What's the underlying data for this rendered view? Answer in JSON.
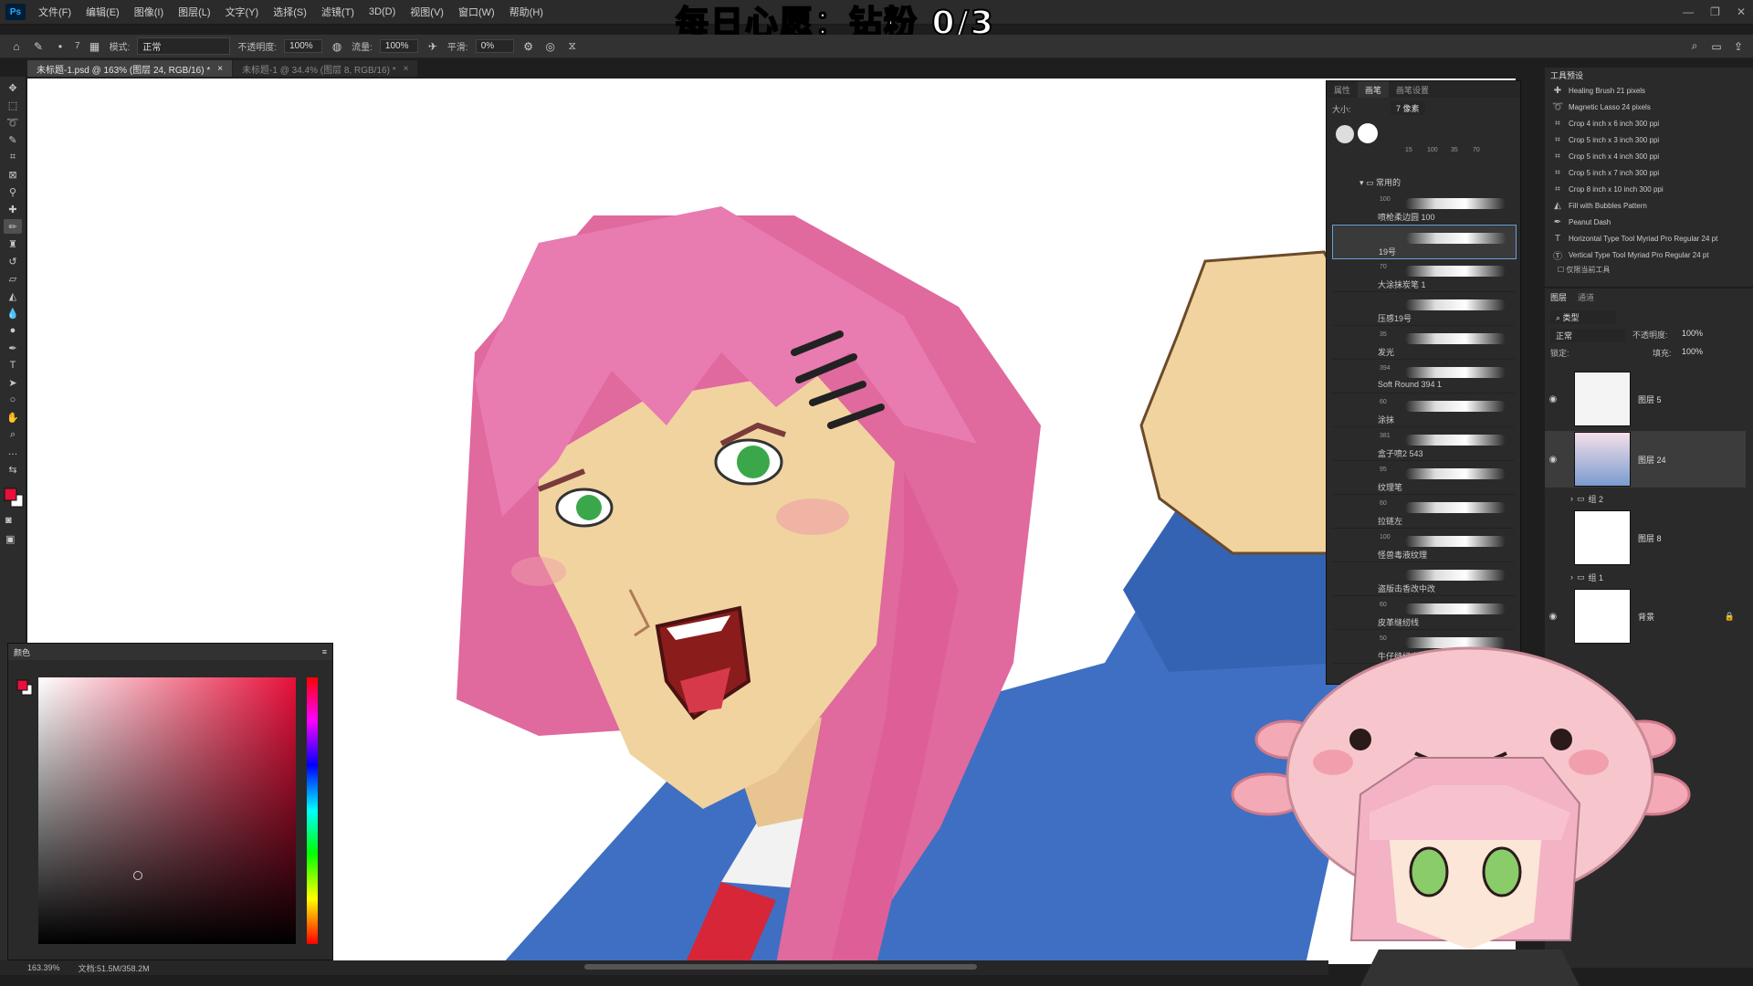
{
  "app": {
    "logo": "Ps"
  },
  "menubar": {
    "items": [
      "文件(F)",
      "编辑(E)",
      "图像(I)",
      "图层(L)",
      "文字(Y)",
      "选择(S)",
      "滤镜(T)",
      "3D(D)",
      "视图(V)",
      "窗口(W)",
      "帮助(H)"
    ]
  },
  "overlay": {
    "title": "每日心愿：钻粉 0/3"
  },
  "options": {
    "brush_size": "7",
    "mode_label": "模式:",
    "mode_value": "正常",
    "opacity_label": "不透明度:",
    "opacity_value": "100%",
    "flow_label": "流量:",
    "flow_value": "100%",
    "smooth_label": "平滑:",
    "smooth_value": "0%"
  },
  "tabs": [
    {
      "label": "未标题-1.psd @ 163% (图层 24, RGB/16) *"
    },
    {
      "label": "未标题-1 @ 34.4% (图层 8, RGB/16) *"
    }
  ],
  "status": {
    "zoom": "163.39%",
    "doc": "文档:51.5M/358.2M"
  },
  "color_panel": {
    "title": "颜色",
    "fg": "#e8103a",
    "bg": "#ffffff"
  },
  "brush_panel": {
    "tabs": [
      "属性",
      "画笔",
      "画笔设置"
    ],
    "size_label": "大小:",
    "size_value": "7 像素",
    "tip_sizes": [
      "15",
      "100",
      "35",
      "70"
    ],
    "folder": "常用的",
    "brushes": [
      {
        "size": "100",
        "name": "喷枪柔边圆 100"
      },
      {
        "size": "",
        "name": "19号"
      },
      {
        "size": "70",
        "name": "大涂抹炭笔 1"
      },
      {
        "size": "",
        "name": "压感19号"
      },
      {
        "size": "35",
        "name": "发光"
      },
      {
        "size": "394",
        "name": "Soft Round 394 1"
      },
      {
        "size": "60",
        "name": "涂抹"
      },
      {
        "size": "381",
        "name": "盒子喷2 543"
      },
      {
        "size": "95",
        "name": "纹理笔"
      },
      {
        "size": "60",
        "name": "拉链左"
      },
      {
        "size": "100",
        "name": "怪兽毒液纹理"
      },
      {
        "size": "",
        "name": "盗版击香改中改"
      },
      {
        "size": "60",
        "name": "皮革缝纫线"
      },
      {
        "size": "50",
        "name": "牛仔缝纫实验"
      }
    ]
  },
  "presets_panel": {
    "title": "工具预设",
    "items": [
      {
        "icon": "healing-brush-icon",
        "name": "Healing Brush 21 pixels"
      },
      {
        "icon": "magnetic-lasso-icon",
        "name": "Magnetic Lasso 24 pixels"
      },
      {
        "icon": "crop-icon",
        "name": "Crop 4 inch x 6 inch 300 ppi"
      },
      {
        "icon": "crop-icon",
        "name": "Crop 5 inch x 3 inch 300 ppi"
      },
      {
        "icon": "crop-icon",
        "name": "Crop 5 inch x 4 inch 300 ppi"
      },
      {
        "icon": "crop-icon",
        "name": "Crop 5 inch x 7 inch 300 ppi"
      },
      {
        "icon": "crop-icon",
        "name": "Crop 8 inch x 10 inch 300 ppi"
      },
      {
        "icon": "paint-bucket-icon",
        "name": "Fill with Bubbles Pattern"
      },
      {
        "icon": "pen-icon",
        "name": "Peanut Dash"
      },
      {
        "icon": "type-icon",
        "name": "Horizontal Type Tool Myriad Pro Regular 24 pt"
      },
      {
        "icon": "vertical-type-icon",
        "name": "Vertical Type Tool Myriad Pro Regular 24 pt"
      }
    ],
    "current_only": "仅限当前工具"
  },
  "layers_panel": {
    "tabs": [
      "图层",
      "通道"
    ],
    "filter_label": "类型",
    "blend_mode": "正常",
    "opacity_label": "不透明度:",
    "opacity_value": "100%",
    "lock_label": "锁定:",
    "fill_label": "填充:",
    "fill_value": "100%",
    "layers": [
      {
        "name": "图层 5",
        "visible": true
      },
      {
        "name": "图层 24",
        "visible": true
      },
      {
        "name": "组 2",
        "group": true
      },
      {
        "name": "图层 8",
        "visible": false
      },
      {
        "name": "组 1",
        "group": true
      },
      {
        "name": "背景",
        "visible": true,
        "locked": true
      }
    ]
  },
  "colors": {
    "hair": "#e0699e",
    "jacket": "#3f6fc2",
    "skin": "#f1d3a0",
    "eyes": "#3aa84a",
    "tie": "#d62638"
  }
}
